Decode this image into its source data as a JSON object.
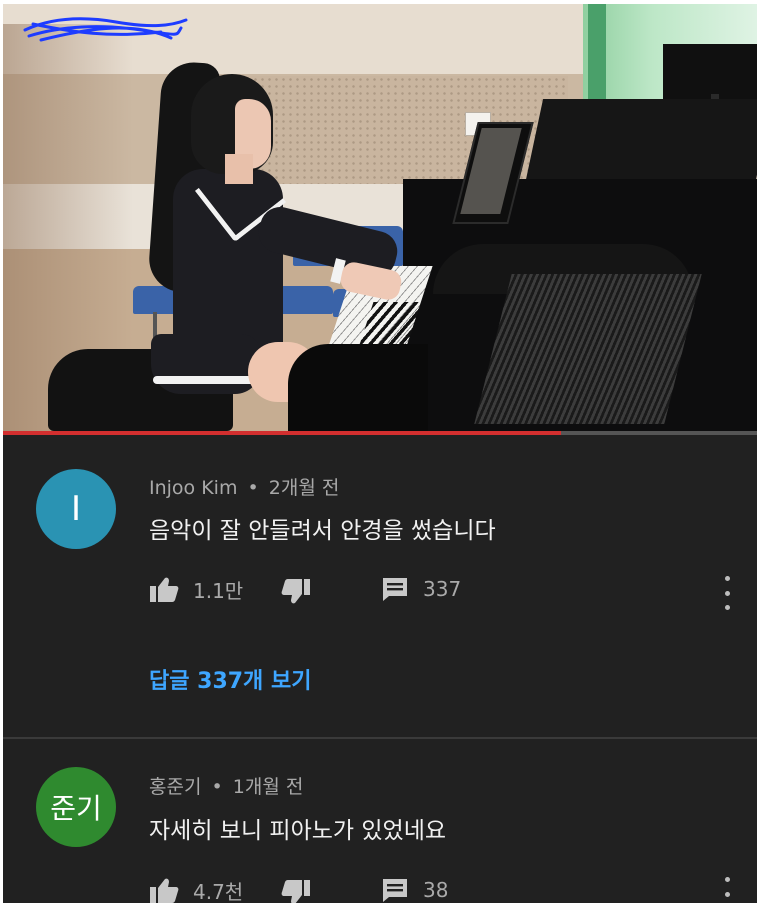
{
  "video": {
    "progress_percent": 74,
    "progress_color": "#d32f2f"
  },
  "comments": [
    {
      "avatar_letter": "I",
      "avatar_color": "#2a93b3",
      "author": "Injoo Kim",
      "separator": "•",
      "time": "2개월 전",
      "text": "음악이 잘 안들려서 안경을 썼습니다",
      "likes": "1.1만",
      "reply_count": "337",
      "view_replies": "답글 337개 보기",
      "like_icon": "thumbs-up-icon",
      "dislike_icon": "thumbs-down-icon",
      "reply_icon": "comment-icon",
      "menu_icon": "more-vert-icon"
    },
    {
      "avatar_letter": "준기",
      "avatar_color": "#2f8a2f",
      "author": "홍준기",
      "separator": "•",
      "time": "1개월 전",
      "text": "자세히 보니 피아노가 있었네요",
      "likes": "4.7천",
      "reply_count": "38",
      "like_icon": "thumbs-up-icon",
      "dislike_icon": "thumbs-down-icon",
      "reply_icon": "comment-icon",
      "menu_icon": "more-vert-icon"
    }
  ]
}
